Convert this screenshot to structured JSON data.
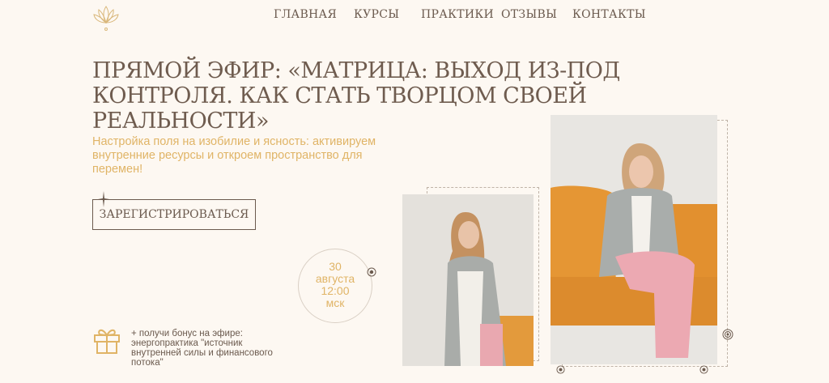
{
  "nav": {
    "items": [
      "ГЛАВНАЯ",
      "КУРСЫ",
      "ПРАКТИКИ",
      "ОТЗЫВЫ",
      "КОНТАКТЫ"
    ]
  },
  "hero": {
    "title": "ПРЯМОЙ ЭФИР: «МАТРИЦА: ВЫХОД ИЗ-ПОД КОНТРОЛЯ. КАК СТАТЬ ТВОРЦОМ СВОЕЙ РЕАЛЬНОСТИ»",
    "subtitle": "Настройка поля на изобилие и ясность: активируем внутренние ресурсы и откроем пространство для перемен!",
    "register_label": "ЗАРЕГИСТРИРОВАТЬСЯ"
  },
  "event": {
    "day": "30",
    "month": "августа",
    "time": "12:00",
    "tz": "мск"
  },
  "bonus": {
    "text": "+ получи бонус на эфире: энергопрактика \"источник внутренней силы и финансового потока\""
  },
  "colors": {
    "background": "#fdf8f2",
    "text": "#6b5a4e",
    "accent": "#e0b466"
  },
  "icons": {
    "logo": "lotus-icon",
    "bonus": "gift-icon",
    "date": "moon-icon"
  }
}
